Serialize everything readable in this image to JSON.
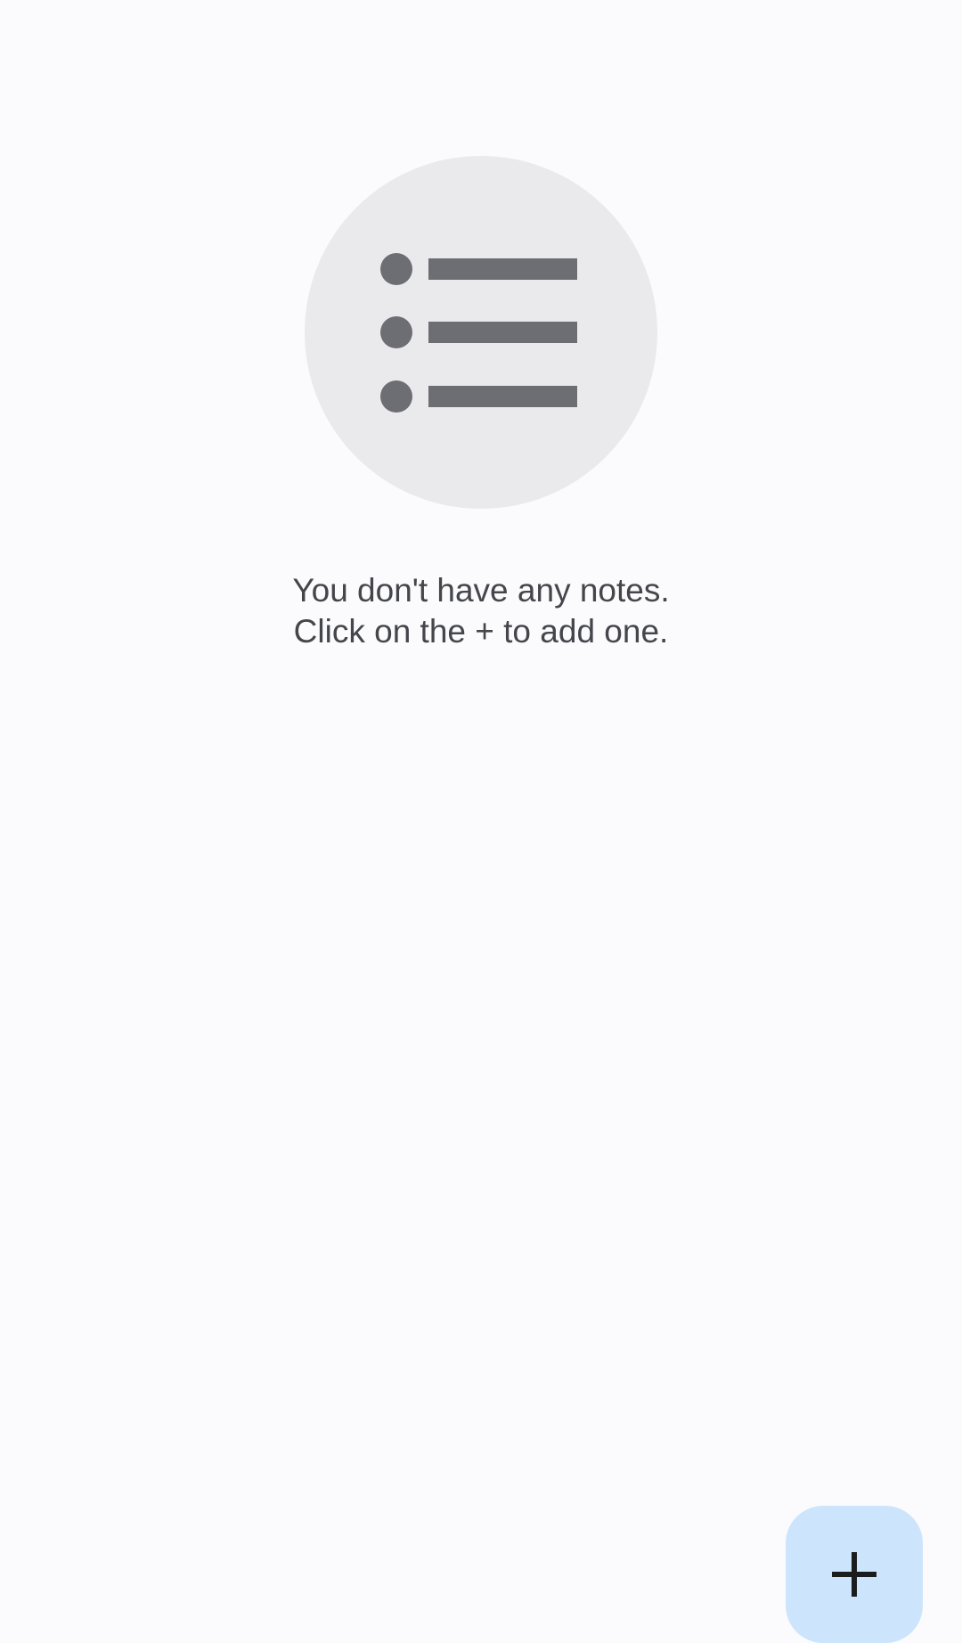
{
  "empty_state": {
    "icon": "list-icon",
    "message_line_1": "You don't have any notes.",
    "message_line_2": "Click on the + to add one."
  },
  "fab": {
    "icon": "plus-icon"
  },
  "colors": {
    "background": "#FBFBFD",
    "circle_background": "#EAEAEC",
    "icon_gray": "#6D6E73",
    "text": "#45464C",
    "fab_background": "#CDE5FC",
    "fab_icon": "#1A1C1E"
  }
}
